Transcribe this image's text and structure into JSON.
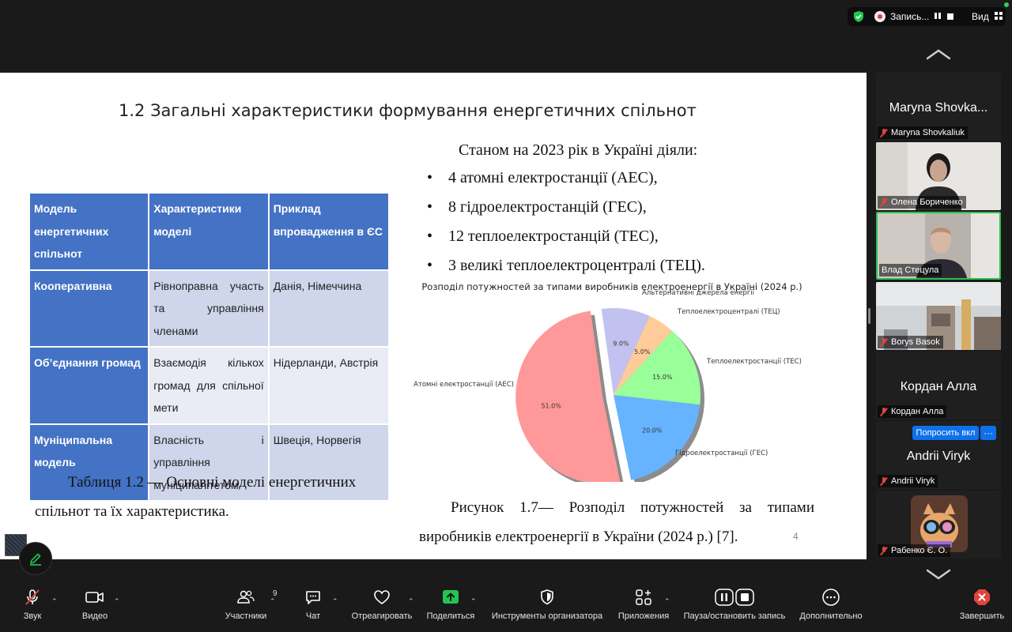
{
  "topbar": {
    "recording_label": "Запись...",
    "view_label": "Вид"
  },
  "slide": {
    "title": "1.2 Загальні характеристики формування енергетичних спільнот",
    "status_heading": "Станом на 2023 рік в Україні діяли:",
    "plants": [
      "4 атомні електростанції (АЕС),",
      "8 гідроелектростанцій (ГЕС),",
      "12 теплоелектростанцій (ТЕС),",
      "3 великі теплоелектроцентралі (ТЕЦ)."
    ],
    "table": {
      "headers": [
        "Модель енергетичних спільнот",
        "Характеристики моделі",
        "Приклад впровадження в ЄС"
      ],
      "rows": [
        [
          "Кооперативна",
          "Рівноправна участь та управління членами",
          "Данія, Німеччина"
        ],
        [
          "Об’єднання громад",
          "Взаємодія кількох громад для спільної мети",
          "Нідерланди, Австрія"
        ],
        [
          "Муніципальна модель",
          "Власність і управління муніципалітетом",
          "Швеція, Норвегія"
        ]
      ]
    },
    "table_caption": "Таблиця 1.2 — Основні моделі енергетичних спільнот та їх характеристика.",
    "figure_caption": "Рисунок 1.7— Розподіл потужностей за типами виробників електроенергії в України (2024 р.) [7].",
    "page_number": "4"
  },
  "chart_data": {
    "type": "pie",
    "title": "Розподіл потужностей за типами виробників електроенергії в Україні (2024 р.)",
    "slices": [
      {
        "label": "Атомні електростанції (АЕС)",
        "value": 51.0,
        "pct_label": "51.0%",
        "color": "#ff9999",
        "exploded": true
      },
      {
        "label": "Гідроелектростанції (ГЕС)",
        "value": 20.0,
        "pct_label": "20.0%",
        "color": "#66b3ff",
        "exploded": false
      },
      {
        "label": "Теплоелектростанції (ТЕС)",
        "value": 15.0,
        "pct_label": "15.0%",
        "color": "#99ff99",
        "exploded": false
      },
      {
        "label": "Теплоелектроцентралі (ТЕЦ)",
        "value": 5.0,
        "pct_label": "5.0%",
        "color": "#ffcc99",
        "exploded": false
      },
      {
        "label": "Альтернативні джерела енергії",
        "value": 9.0,
        "pct_label": "9.0%",
        "color": "#c2c2f0",
        "exploded": false
      }
    ],
    "shadow": true
  },
  "participants": [
    {
      "name": "Maryna Shovkaliuk",
      "display_name": "Maryna Shovka...",
      "video": false
    },
    {
      "name": "Олена Бориченко",
      "video": true
    },
    {
      "name": "Влад Стецула",
      "video": true,
      "active_speaker": true
    },
    {
      "name": "Borys Basok",
      "video": true
    },
    {
      "name": "Кордан Алла",
      "display_name": "Кордан Алла",
      "video": false
    },
    {
      "name": "Andrii Viryk",
      "display_name": "Andrii Viryk",
      "video": false
    },
    {
      "name": "Рабенко Є. О.",
      "video": false,
      "avatar": true
    }
  ],
  "gallery_actions": {
    "ask_unmute": "Попросить вкл",
    "more": "···"
  },
  "toolbar": {
    "audio": "Звук",
    "video": "Видео",
    "participants": "Участники",
    "participants_count": "9",
    "chat": "Чат",
    "react": "Отреагировать",
    "share": "Поделиться",
    "host_tools": "Инструменты организатора",
    "apps": "Приложения",
    "record": "Пауза/остановить запись",
    "more": "Дополнительно",
    "end": "Завершить"
  },
  "colors": {
    "table_header": "#4472c4",
    "table_odd": "#cfd5ea",
    "table_even": "#e9ebf5",
    "share_green": "#23c552",
    "end_red": "#e0443e",
    "active_border": "#2fbf4f",
    "ask_button": "#0e71eb"
  }
}
